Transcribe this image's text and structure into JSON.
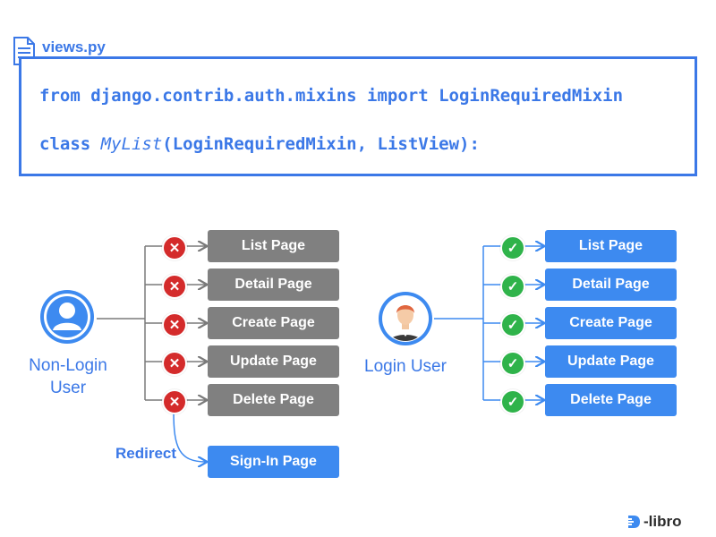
{
  "file": {
    "name": "views.py",
    "icon": "file-icon"
  },
  "code": {
    "line1": "from django.contrib.auth.mixins import LoginRequiredMixin",
    "line2_prefix": "class ",
    "line2_class_name": "MyList",
    "line2_suffix": "(LoginRequiredMixin, ListView):"
  },
  "non_login": {
    "label_line1": "Non-Login",
    "label_line2": "User",
    "icon": "user-icon",
    "status_icon": "x-circle-icon",
    "pages": [
      {
        "label": "List Page"
      },
      {
        "label": "Detail Page"
      },
      {
        "label": "Create Page"
      },
      {
        "label": "Update Page"
      },
      {
        "label": "Delete Page"
      }
    ],
    "redirect_label": "Redirect",
    "redirect_page": "Sign-In Page"
  },
  "login": {
    "label": "Login User",
    "icon": "person-avatar-icon",
    "status_icon": "check-circle-icon",
    "pages": [
      {
        "label": "List Page"
      },
      {
        "label": "Detail Page"
      },
      {
        "label": "Create Page"
      },
      {
        "label": "Update Page"
      },
      {
        "label": "Delete Page"
      }
    ]
  },
  "brand": {
    "text": "-libro",
    "icon": "d-libro-logo-icon"
  },
  "colors": {
    "accent": "#3b78e7",
    "gray_button": "#808080",
    "blue_button": "#3d8af0",
    "deny": "#d42b2b",
    "allow": "#2fb34a"
  }
}
